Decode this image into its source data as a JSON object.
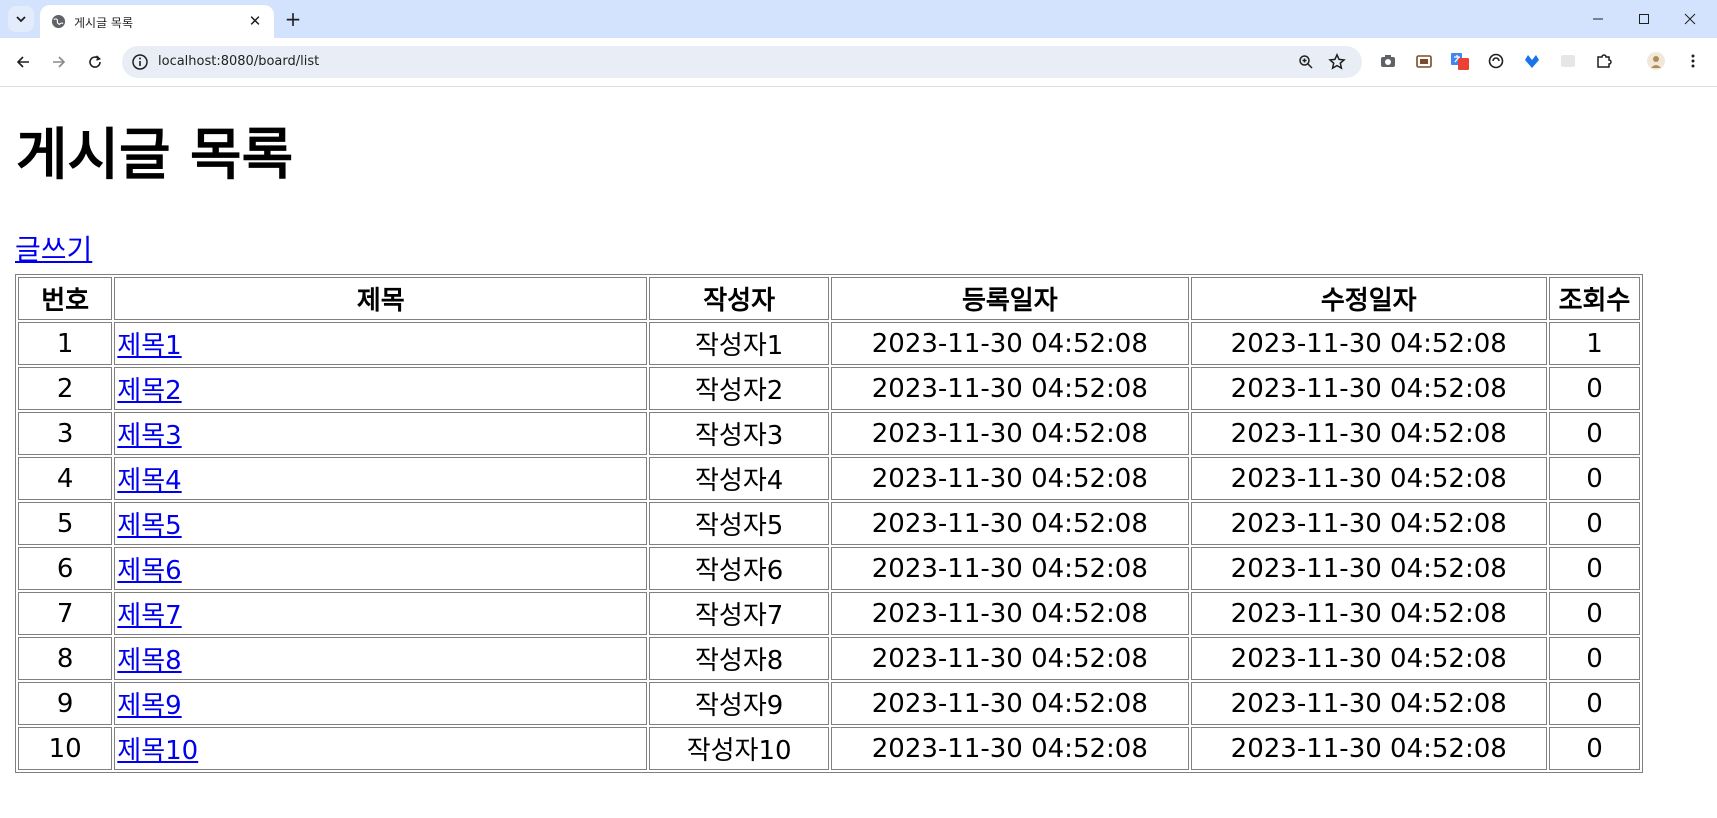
{
  "browser": {
    "tab": {
      "title": "게시글 목록",
      "favicon": "globe-icon"
    },
    "address_bar": {
      "url": "localhost:8080/board/list"
    }
  },
  "page": {
    "heading": "게시글 목록",
    "write_link": "글쓰기",
    "table": {
      "headers": [
        "번호",
        "제목",
        "작성자",
        "등록일자",
        "수정일자",
        "조회수"
      ],
      "rows": [
        {
          "no": "1",
          "title": "제목1",
          "writer": "작성자1",
          "created": "2023-11-30 04:52:08",
          "updated": "2023-11-30 04:52:08",
          "views": "1"
        },
        {
          "no": "2",
          "title": "제목2",
          "writer": "작성자2",
          "created": "2023-11-30 04:52:08",
          "updated": "2023-11-30 04:52:08",
          "views": "0"
        },
        {
          "no": "3",
          "title": "제목3",
          "writer": "작성자3",
          "created": "2023-11-30 04:52:08",
          "updated": "2023-11-30 04:52:08",
          "views": "0"
        },
        {
          "no": "4",
          "title": "제목4",
          "writer": "작성자4",
          "created": "2023-11-30 04:52:08",
          "updated": "2023-11-30 04:52:08",
          "views": "0"
        },
        {
          "no": "5",
          "title": "제목5",
          "writer": "작성자5",
          "created": "2023-11-30 04:52:08",
          "updated": "2023-11-30 04:52:08",
          "views": "0"
        },
        {
          "no": "6",
          "title": "제목6",
          "writer": "작성자6",
          "created": "2023-11-30 04:52:08",
          "updated": "2023-11-30 04:52:08",
          "views": "0"
        },
        {
          "no": "7",
          "title": "제목7",
          "writer": "작성자7",
          "created": "2023-11-30 04:52:08",
          "updated": "2023-11-30 04:52:08",
          "views": "0"
        },
        {
          "no": "8",
          "title": "제목8",
          "writer": "작성자8",
          "created": "2023-11-30 04:52:08",
          "updated": "2023-11-30 04:52:08",
          "views": "0"
        },
        {
          "no": "9",
          "title": "제목9",
          "writer": "작성자9",
          "created": "2023-11-30 04:52:08",
          "updated": "2023-11-30 04:52:08",
          "views": "0"
        },
        {
          "no": "10",
          "title": "제목10",
          "writer": "작성자10",
          "created": "2023-11-30 04:52:08",
          "updated": "2023-11-30 04:52:08",
          "views": "0"
        }
      ]
    }
  },
  "colors": {
    "tabbar_bg": "#d3e3fd",
    "omnibox_bg": "#e9eef6",
    "link": "#0000ee"
  }
}
